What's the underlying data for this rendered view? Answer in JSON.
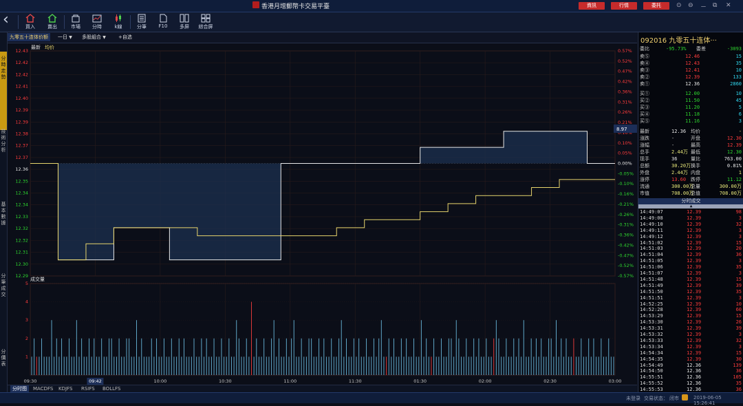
{
  "window": {
    "title": "香港月增郵幣卡交易平臺",
    "buttons": [
      "資訊",
      "行情",
      "委托"
    ],
    "controls": [
      "⊙",
      "⊖",
      "－",
      "⧉",
      "✕"
    ]
  },
  "toolbar": {
    "back": "‹",
    "items": [
      {
        "label": "買入",
        "icon": "home-buy-icon"
      },
      {
        "label": "賣出",
        "icon": "home-sell-icon"
      },
      {
        "label": "市場",
        "icon": "market-bag-icon"
      },
      {
        "label": "分時",
        "icon": "timeshare-chart-icon"
      },
      {
        "label": "k線",
        "icon": "candlestick-icon"
      },
      {
        "label": "分筆",
        "icon": "ticks-list-icon"
      },
      {
        "label": "F10",
        "icon": "document-icon"
      },
      {
        "label": "多屏",
        "icon": "multiscreen-icon"
      },
      {
        "label": "綜合屏",
        "icon": "grid-screen-icon"
      }
    ]
  },
  "leftnav": [
    "分時走勢",
    "技術分析",
    "基本數據",
    "分筆成交",
    "分價表"
  ],
  "tabs": {
    "product": "九零五十连体价额",
    "period": "一日",
    "period_arrow": "▼",
    "compare": "多股組合",
    "compare_arrow": "▼",
    "add": "+自选"
  },
  "chart": {
    "legend_latest": "最新",
    "legend_avg": "均价",
    "price_axis": [
      "12.43",
      "12.42",
      "12.42",
      "12.41",
      "12.40",
      "12.39",
      "12.39",
      "12.38",
      "12.37",
      "12.37",
      "12.36",
      "12.35",
      "12.34",
      "12.34",
      "12.33",
      "12.32",
      "12.32",
      "12.31",
      "12.30",
      "12.29"
    ],
    "pct_axis": [
      "0.57%",
      "0.52%",
      "0.47%",
      "0.42%",
      "0.36%",
      "0.31%",
      "0.26%",
      "0.21%",
      "0.16%",
      "0.10%",
      "0.05%",
      "0.00%",
      "-0.05%",
      "-0.10%",
      "-0.16%",
      "-0.21%",
      "-0.26%",
      "-0.31%",
      "-0.36%",
      "-0.42%",
      "-0.47%",
      "-0.52%",
      "-0.57%"
    ],
    "cursor_value": "8.97",
    "volume_title": "成交量",
    "volume_axis": [
      "5",
      "4",
      "3",
      "2",
      "1"
    ],
    "time_axis": [
      "09:30",
      "09:42",
      "10:00",
      "10:30",
      "11:00",
      "11:30",
      "01:30",
      "02:00",
      "02:30",
      "03:00"
    ],
    "time_highlight": "09:42"
  },
  "chart_data": {
    "type": "line",
    "title": "",
    "ylim": [
      12.29,
      12.43
    ],
    "x": [
      "09:30",
      "09:33",
      "09:35",
      "09:36",
      "10:13",
      "10:14",
      "10:20",
      "10:28",
      "10:50",
      "10:51",
      "11:00",
      "11:07",
      "11:12",
      "11:15",
      "01:40",
      "01:55",
      "02:20",
      "02:30",
      "02:40",
      "02:47",
      "02:55",
      "03:00"
    ],
    "series": [
      {
        "name": "最新",
        "color": "#e8e8e8",
        "values": [
          12.36,
          12.3,
          12.3,
          12.32,
          12.32,
          12.3,
          12.3,
          12.3,
          12.3,
          12.36,
          12.36,
          12.36,
          12.36,
          12.36,
          12.37,
          12.37,
          12.37,
          12.38,
          12.38,
          12.38,
          12.36,
          12.36
        ]
      },
      {
        "name": "均价",
        "color": "#e8d56c",
        "values": [
          12.36,
          12.3,
          12.31,
          12.32,
          12.32,
          12.32,
          12.315,
          12.315,
          12.315,
          12.315,
          12.315,
          12.32,
          12.325,
          12.325,
          12.33,
          12.335,
          12.34,
          12.34,
          12.345,
          12.35,
          12.35,
          12.35
        ]
      }
    ],
    "volume": {
      "ylim": [
        0,
        5
      ],
      "values": [
        1,
        2,
        1,
        1,
        2,
        1,
        1,
        1,
        3,
        1,
        2,
        1,
        2,
        1,
        1,
        2,
        1,
        1,
        3,
        1,
        2,
        1,
        1,
        2,
        1,
        2,
        1,
        1,
        2,
        1,
        1,
        2,
        2,
        1,
        1,
        2,
        1,
        1,
        2,
        2,
        1,
        1,
        3,
        1,
        2,
        1,
        1,
        1,
        2,
        1,
        2,
        1,
        1,
        2,
        1,
        1,
        2,
        1,
        1,
        2,
        1,
        2,
        1,
        1,
        1,
        2,
        1,
        1,
        2,
        1,
        2,
        1,
        1,
        2,
        1,
        1,
        2,
        1,
        1,
        2,
        1,
        1,
        3,
        2,
        1,
        1,
        2,
        1,
        4,
        1,
        2,
        1,
        1,
        2,
        1,
        1,
        2,
        3,
        1,
        2,
        1,
        1,
        2,
        1,
        2,
        3,
        1,
        1,
        2,
        1,
        1,
        2,
        2,
        1,
        1,
        2,
        1,
        2,
        1,
        1,
        2,
        1,
        1,
        2,
        3,
        1,
        2,
        1,
        1,
        2,
        1,
        2,
        1,
        1,
        2,
        1,
        1,
        2,
        1,
        2,
        3,
        1,
        1,
        2,
        1,
        2,
        1,
        1,
        2,
        1,
        2,
        1,
        1,
        2,
        1,
        1,
        3,
        1,
        2,
        1,
        1,
        2,
        1,
        1,
        2,
        1,
        1,
        2,
        2,
        1,
        3,
        2,
        1,
        1,
        2,
        1,
        1,
        2,
        1,
        2,
        1,
        1,
        2,
        1,
        1,
        2,
        3,
        2,
        1,
        1,
        2,
        1,
        1,
        2,
        1,
        2,
        1,
        3,
        1,
        1,
        2,
        1,
        2,
        1,
        2,
        1,
        1,
        2,
        2,
        1,
        3,
        1,
        2,
        1,
        2,
        1,
        1,
        2,
        1,
        1,
        2,
        1,
        1,
        2,
        1,
        2,
        1,
        1,
        2,
        1,
        1,
        2,
        1,
        1
      ],
      "red_indices": [
        2,
        88,
        142,
        160,
        185,
        217
      ]
    }
  },
  "quote": {
    "code": "092016",
    "name": "九零五十连体···",
    "weibi_label": "委比",
    "weibi_value": "-95.73%",
    "weicha_label": "委差",
    "weicha_value": "-3093",
    "sell": [
      {
        "label": "卖⑤",
        "price": "12.46",
        "vol": "15"
      },
      {
        "label": "卖④",
        "price": "12.43",
        "vol": "35"
      },
      {
        "label": "卖③",
        "price": "12.41",
        "vol": "10"
      },
      {
        "label": "卖②",
        "price": "12.39",
        "vol": "133"
      },
      {
        "label": "卖①",
        "price": "12.36",
        "vol": "2860"
      }
    ],
    "buy": [
      {
        "label": "买①",
        "price": "12.00",
        "vol": "10"
      },
      {
        "label": "买②",
        "price": "11.50",
        "vol": "45"
      },
      {
        "label": "买③",
        "price": "11.20",
        "vol": "5"
      },
      {
        "label": "买④",
        "price": "11.18",
        "vol": "6"
      },
      {
        "label": "买⑤",
        "price": "11.16",
        "vol": "3"
      }
    ],
    "stats": [
      [
        "最新",
        "12.36",
        "均价",
        "-"
      ],
      [
        "涨跌",
        "-",
        "开盘",
        "12.30"
      ],
      [
        "涨幅",
        "-",
        "最高",
        "12.39"
      ],
      [
        "总手",
        "2.44万",
        "最低",
        "12.30"
      ],
      [
        "现手",
        "36",
        "量比",
        "763.00"
      ],
      [
        "总额",
        "30.20万",
        "换手",
        "0.81%"
      ],
      [
        "外盘",
        "2.44万",
        "内盘",
        "1"
      ],
      [
        "涨停",
        "13.60",
        "跌停",
        "11.12"
      ],
      [
        "流通",
        "300.00万",
        "总量",
        "300.00万"
      ],
      [
        "市值",
        "708.00万",
        "总值",
        "708.00万"
      ]
    ],
    "ticks_title": "分时成交",
    "ticks_arrow": "▲",
    "ticks": [
      [
        "14:49:07",
        "12.39",
        "98"
      ],
      [
        "14:49:08",
        "12.39",
        "3"
      ],
      [
        "14:49:10",
        "12.39",
        "32"
      ],
      [
        "14:49:11",
        "12.39",
        "3"
      ],
      [
        "14:49:12",
        "12.39",
        "3"
      ],
      [
        "14:51:02",
        "12.39",
        "15"
      ],
      [
        "14:51:03",
        "12.39",
        "20"
      ],
      [
        "14:51:04",
        "12.39",
        "36"
      ],
      [
        "14:51:05",
        "12.39",
        "3"
      ],
      [
        "14:51:06",
        "12.39",
        "35"
      ],
      [
        "14:51:07",
        "12.39",
        "3"
      ],
      [
        "14:51:48",
        "12.39",
        "15"
      ],
      [
        "14:51:49",
        "12.39",
        "39"
      ],
      [
        "14:51:50",
        "12.39",
        "35"
      ],
      [
        "14:51:51",
        "12.39",
        "3"
      ],
      [
        "14:52:25",
        "12.39",
        "10"
      ],
      [
        "14:52:28",
        "12.39",
        "60"
      ],
      [
        "14:53:29",
        "12.39",
        "15"
      ],
      [
        "14:53:30",
        "12.39",
        "26"
      ],
      [
        "14:53:31",
        "12.39",
        "39"
      ],
      [
        "14:53:32",
        "12.39",
        "3"
      ],
      [
        "14:53:33",
        "12.39",
        "32"
      ],
      [
        "14:53:34",
        "12.39",
        "3"
      ],
      [
        "14:54:34",
        "12.39",
        "15"
      ],
      [
        "14:54:35",
        "12.39",
        "30"
      ],
      [
        "14:54:49",
        "12.36",
        "139"
      ],
      [
        "14:54:50",
        "12.36",
        "36"
      ],
      [
        "14:55:51",
        "12.36",
        "105"
      ],
      [
        "14:55:52",
        "12.36",
        "35"
      ],
      [
        "14:55:53",
        "12.36",
        "36"
      ]
    ]
  },
  "bottom_tabs": [
    "分时图",
    "MACDFS",
    "KDJFS",
    "RSIFS",
    "BOLLFS"
  ],
  "status": {
    "login": "未登录",
    "trade_label": "交易状态：",
    "trade_value": "闭市",
    "datetime": "2019-06-05 15:26:41"
  },
  "colors": {
    "up": "#ff3c3c",
    "down": "#2fd82f",
    "neutral": "#e8e8e8",
    "cyan": "#31d8f0",
    "yellow": "#e8d56c",
    "accent": "#c62b2b"
  }
}
